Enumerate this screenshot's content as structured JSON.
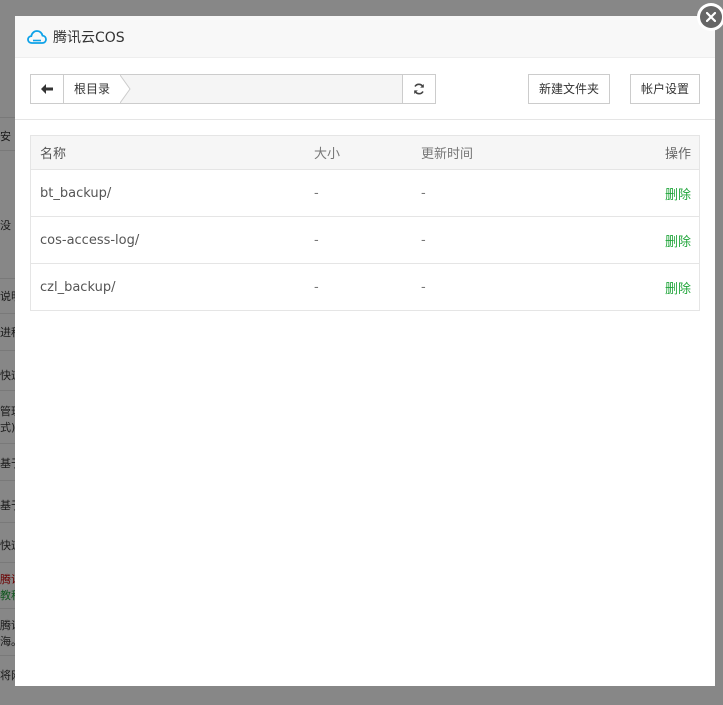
{
  "background": {
    "fragments": [
      "安",
      "没",
      "说明",
      "进程",
      "快速",
      "管理",
      "式)",
      "基于",
      "基于",
      "快速",
      "腾讯",
      "教程",
      "腾讯",
      "海。",
      "将网"
    ]
  },
  "dialog": {
    "title": "腾讯云COS",
    "icon": "cloud-icon",
    "close_icon": "close-icon"
  },
  "toolbar": {
    "back_icon": "arrow-left-icon",
    "breadcrumb": [
      "根目录"
    ],
    "refresh_icon": "refresh-icon",
    "new_folder_label": "新建文件夹",
    "account_settings_label": "帐户设置"
  },
  "table": {
    "headers": {
      "name": "名称",
      "size": "大小",
      "updated": "更新时间",
      "actions": "操作"
    },
    "rows": [
      {
        "name": "bt_backup/",
        "size": "-",
        "updated": "-",
        "action": "删除"
      },
      {
        "name": "cos-access-log/",
        "size": "-",
        "updated": "-",
        "action": "删除"
      },
      {
        "name": "czl_backup/",
        "size": "-",
        "updated": "-",
        "action": "删除"
      }
    ]
  },
  "colors": {
    "accent": "#20a53a",
    "brand_cloud": "#0ea2e8"
  }
}
